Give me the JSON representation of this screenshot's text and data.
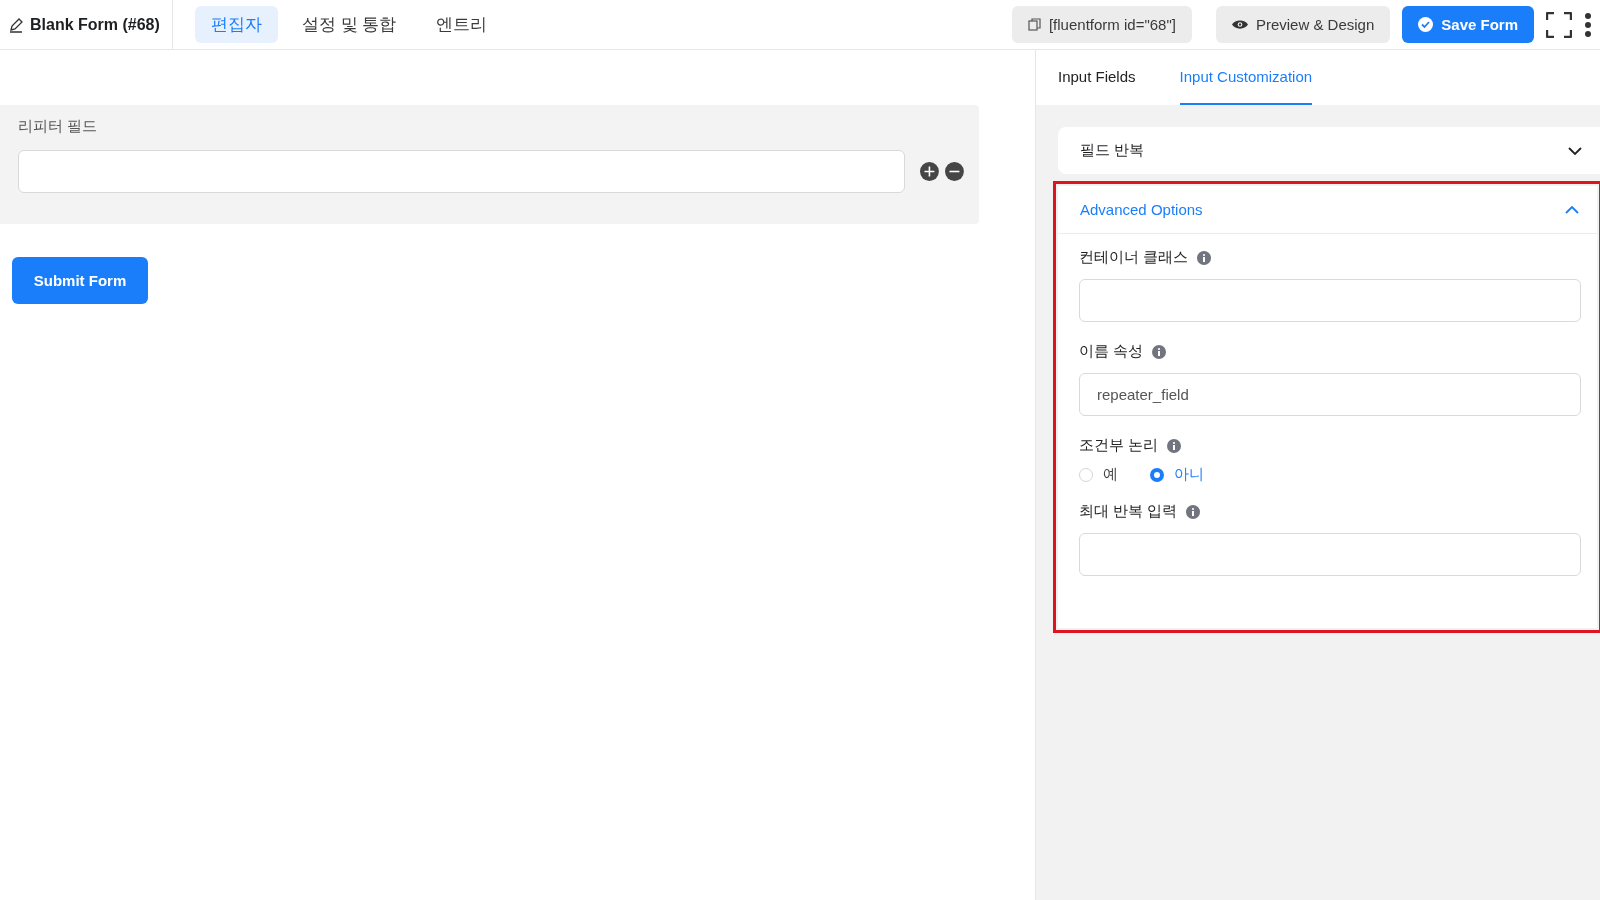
{
  "header": {
    "title": "Blank Form (#68)",
    "tabs": [
      {
        "label": "편집자",
        "selected": true
      },
      {
        "label": "설정 및 통합",
        "selected": false
      },
      {
        "label": "엔트리",
        "selected": false
      }
    ],
    "shortcode": "[fluentform id=\"68\"]",
    "preview_button": "Preview & Design",
    "save_button": "Save Form"
  },
  "canvas": {
    "repeater": {
      "label": "리피터 필드"
    },
    "submit_button": "Submit Form"
  },
  "sidebar": {
    "tabs": [
      {
        "label": "Input Fields",
        "selected": false
      },
      {
        "label": "Input Customization",
        "selected": true
      }
    ],
    "sections": [
      {
        "title": "필드 반복",
        "expanded": false,
        "highlighted": false
      },
      {
        "title": "Advanced Options",
        "expanded": true,
        "highlighted": true,
        "fields": [
          {
            "kind": "text",
            "label": "컨테이너 클래스"
          },
          {
            "kind": "text",
            "label": "이름 속성",
            "value": "repeater_field"
          },
          {
            "kind": "radio",
            "label": "조건부 논리",
            "options": [
              {
                "label": "예",
                "selected": false
              },
              {
                "label": "아니",
                "selected": true
              }
            ]
          },
          {
            "kind": "text",
            "label": "최대 반복 입력"
          }
        ]
      }
    ]
  }
}
